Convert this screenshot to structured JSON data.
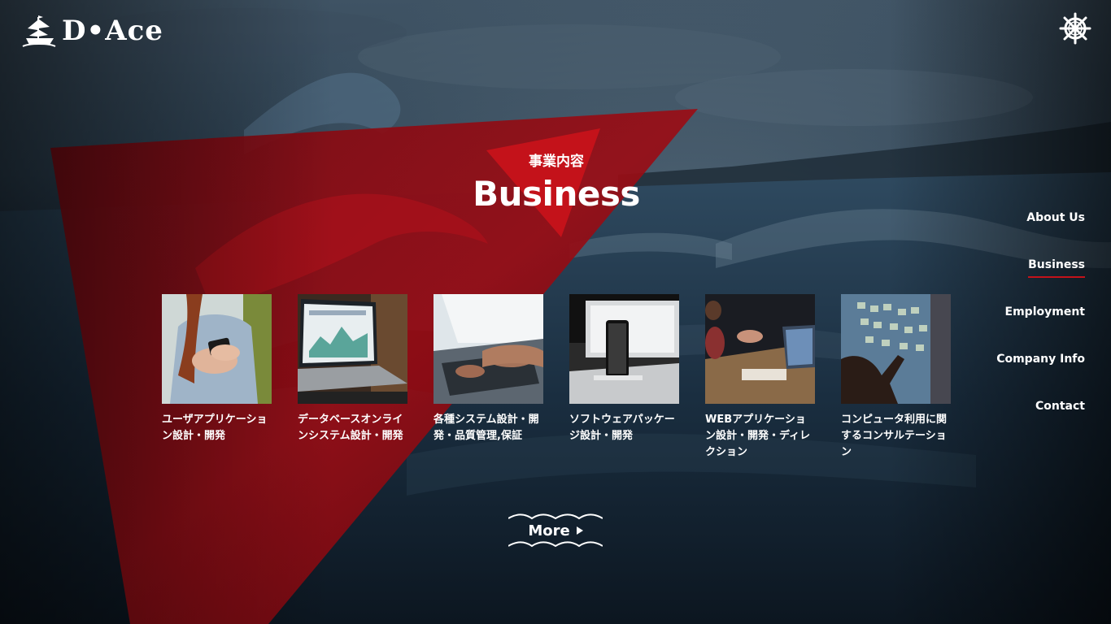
{
  "brand": {
    "name": "D•Ace"
  },
  "menu": {
    "icon": "ships-wheel-icon"
  },
  "section": {
    "title_jp": "事業内容",
    "title_en": "Business"
  },
  "nav": {
    "items": [
      {
        "label": "About Us",
        "active": false
      },
      {
        "label": "Business",
        "active": true
      },
      {
        "label": "Employment",
        "active": false
      },
      {
        "label": "Company Info",
        "active": false
      },
      {
        "label": "Contact",
        "active": false
      }
    ]
  },
  "services": [
    {
      "label": "ユーザアプリケーション設計・開発",
      "image": "person-using-smartphone"
    },
    {
      "label": "データベースオンラインシステム設計・開発",
      "image": "laptop-dashboard-charts"
    },
    {
      "label": "各種システム設計・開発・品質管理,保証",
      "image": "hands-typing-laptop"
    },
    {
      "label": "ソフトウェアパッケージ設計・開発",
      "image": "smartphone-and-monitor"
    },
    {
      "label": "WEBアプリケーション設計・開発・ディレクション",
      "image": "team-meeting-laptop"
    },
    {
      "label": "コンピュータ利用に関するコンサルテーション",
      "image": "sticky-notes-wall"
    }
  ],
  "more": {
    "label": "More"
  },
  "colors": {
    "accent": "#c4121a",
    "background": "#0b1622",
    "text": "#ffffff"
  }
}
